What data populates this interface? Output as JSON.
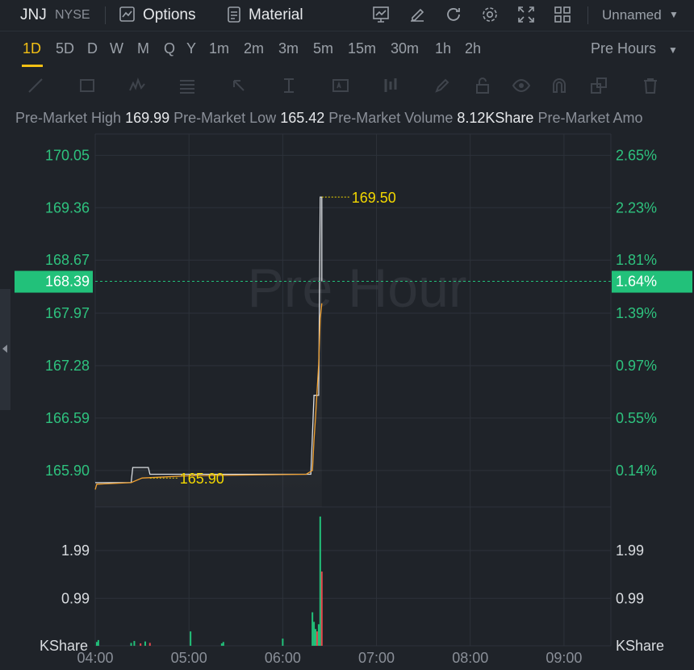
{
  "header": {
    "symbol": "JNJ",
    "exchange": "NYSE",
    "options_label": "Options",
    "material_label": "Material",
    "layout_name": "Unnamed"
  },
  "timeframes": {
    "items": [
      "1D",
      "5D",
      "D",
      "W",
      "M",
      "Q",
      "Y",
      "1m",
      "2m",
      "3m",
      "5m",
      "15m",
      "30m",
      "1h",
      "2h"
    ],
    "active": "1D",
    "session_label": "Pre Hours"
  },
  "stats": [
    {
      "label": "Pre-Market High",
      "value": "169.99"
    },
    {
      "label": "Pre-Market Low",
      "value": "165.42"
    },
    {
      "label": "Pre-Market Volume",
      "value": "8.12KShare"
    },
    {
      "label": "Pre-Market Amo",
      "value": ""
    }
  ],
  "colors": {
    "background": "#1f2329",
    "grid": "#2d323a",
    "axis_text": "#2ec27e",
    "price_line": "#d9dce0",
    "avg_line": "#f0a030",
    "label_yellow": "#f3d800",
    "current_badge": "#22c17a",
    "volume_up": "#22c17a",
    "volume_down": "#e5484d"
  },
  "chart_data": {
    "type": "line",
    "watermark": "Pre Hour",
    "x_ticks": [
      "04:00",
      "05:00",
      "06:00",
      "07:00",
      "08:00",
      "09:00"
    ],
    "x_range": [
      "04:00",
      "09:30"
    ],
    "price_axis": {
      "ticks": [
        "170.05",
        "169.36",
        "168.67",
        "167.97",
        "167.28",
        "166.59",
        "165.90"
      ],
      "ylim": [
        165.42,
        170.33
      ]
    },
    "percent_axis": {
      "ticks": [
        "2.65%",
        "2.23%",
        "1.81%",
        "1.39%",
        "0.97%",
        "0.55%",
        "0.14%"
      ]
    },
    "current": {
      "price": "168.39",
      "percent": "1.64%",
      "value": 168.39
    },
    "annotations": [
      {
        "text": "169.50",
        "time": "06:25",
        "value": 169.5
      },
      {
        "text": "165.90",
        "time": "04:35",
        "value": 165.8
      }
    ],
    "series": [
      {
        "kind": "price",
        "points": [
          {
            "t": "04:00",
            "v": 165.74
          },
          {
            "t": "04:23",
            "v": 165.74
          },
          {
            "t": "04:24",
            "v": 165.94
          },
          {
            "t": "04:34",
            "v": 165.94
          },
          {
            "t": "04:35",
            "v": 165.85
          },
          {
            "t": "06:18",
            "v": 165.85
          },
          {
            "t": "06:20",
            "v": 166.89
          },
          {
            "t": "06:23",
            "v": 166.89
          },
          {
            "t": "06:24",
            "v": 169.5
          },
          {
            "t": "06:25",
            "v": 169.5
          },
          {
            "t": "06:25",
            "v": 168.39
          }
        ]
      },
      {
        "kind": "average",
        "points": [
          {
            "t": "04:00",
            "v": 165.65
          },
          {
            "t": "04:01",
            "v": 165.72
          },
          {
            "t": "04:23",
            "v": 165.74
          },
          {
            "t": "04:30",
            "v": 165.8
          },
          {
            "t": "05:00",
            "v": 165.83
          },
          {
            "t": "06:15",
            "v": 165.85
          },
          {
            "t": "06:19",
            "v": 165.9
          },
          {
            "t": "06:20",
            "v": 166.3
          },
          {
            "t": "06:21",
            "v": 166.6
          },
          {
            "t": "06:23",
            "v": 167.3
          },
          {
            "t": "06:24",
            "v": 167.9
          },
          {
            "t": "06:25",
            "v": 168.1
          }
        ]
      }
    ],
    "volume": {
      "unit": "KShare",
      "axis_ticks": [
        {
          "label": "1.99",
          "value": 1.99
        },
        {
          "label": "0.99",
          "value": 0.99
        }
      ],
      "ylim": [
        0,
        2.9
      ],
      "bars": [
        {
          "t": "04:01",
          "v": 0.08,
          "dir": "up"
        },
        {
          "t": "04:02",
          "v": 0.12,
          "dir": "up"
        },
        {
          "t": "04:23",
          "v": 0.06,
          "dir": "up"
        },
        {
          "t": "04:25",
          "v": 0.1,
          "dir": "up"
        },
        {
          "t": "04:29",
          "v": 0.05,
          "dir": "down"
        },
        {
          "t": "04:32",
          "v": 0.09,
          "dir": "up"
        },
        {
          "t": "04:35",
          "v": 0.06,
          "dir": "down"
        },
        {
          "t": "05:01",
          "v": 0.3,
          "dir": "up"
        },
        {
          "t": "05:21",
          "v": 0.05,
          "dir": "up"
        },
        {
          "t": "05:22",
          "v": 0.08,
          "dir": "up"
        },
        {
          "t": "06:00",
          "v": 0.15,
          "dir": "up"
        },
        {
          "t": "06:19",
          "v": 0.7,
          "dir": "up"
        },
        {
          "t": "06:20",
          "v": 0.5,
          "dir": "up"
        },
        {
          "t": "06:21",
          "v": 0.35,
          "dir": "up"
        },
        {
          "t": "06:22",
          "v": 0.3,
          "dir": "down"
        },
        {
          "t": "06:23",
          "v": 0.45,
          "dir": "up"
        },
        {
          "t": "06:24",
          "v": 2.7,
          "dir": "up"
        },
        {
          "t": "06:25",
          "v": 1.55,
          "dir": "down"
        }
      ]
    }
  }
}
